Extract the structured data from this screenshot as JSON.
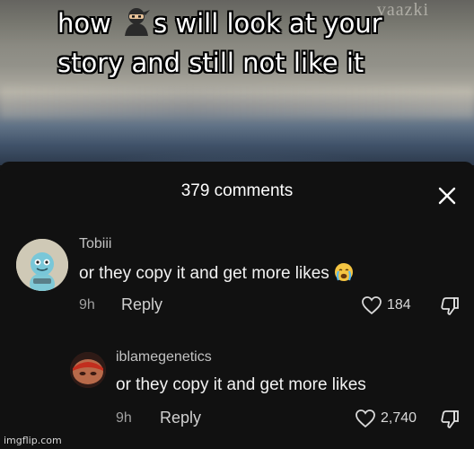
{
  "meme": {
    "caption_before_icon": "how ",
    "caption_after_icon": "s will look at your",
    "caption_line2": "story and still not like it",
    "icon": "ninja-emoji",
    "watermark": "vaazki"
  },
  "sheet": {
    "title": "379 comments",
    "close_icon": "close-x-icon"
  },
  "comments": [
    {
      "username": "Tobiii",
      "text": "or they copy it and get more likes ",
      "emoji": "crying-face-emoji",
      "time": "9h",
      "reply_label": "Reply",
      "likes": "184",
      "avatar_icon": "character-avatar"
    },
    {
      "username": "iblamegenetics",
      "text": "or they copy it and get more likes",
      "time": "9h",
      "reply_label": "Reply",
      "likes": "2,740",
      "avatar_icon": "character-avatar"
    }
  ],
  "footer": {
    "site_watermark": "imgflip.com"
  },
  "colors": {
    "sheet_bg": "#111111",
    "text_primary": "#f2f2f2",
    "text_secondary": "#a0a0a0"
  }
}
